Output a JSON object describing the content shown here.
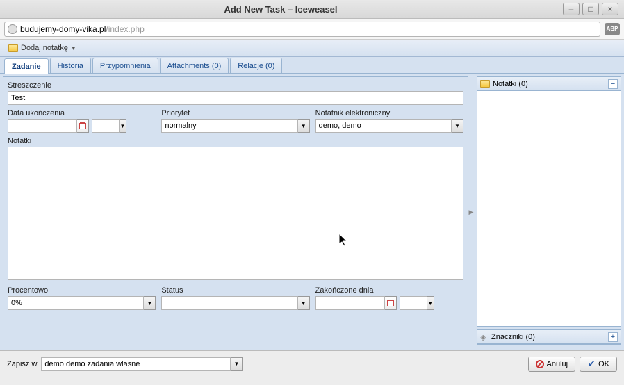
{
  "window": {
    "title": "Add New Task – Iceweasel"
  },
  "url": {
    "domain": "budujemy-domy-vika.pl",
    "path": "/index.php"
  },
  "abp": "ABP",
  "toolbar": {
    "add_note": "Dodaj notatkę"
  },
  "tabs": {
    "task": "Zadanie",
    "history": "Historia",
    "reminders": "Przypomnienia",
    "attachments": "Attachments (0)",
    "relations": "Relacje (0)"
  },
  "form": {
    "summary_label": "Streszczenie",
    "summary_value": "Test",
    "due_label": "Data ukończenia",
    "due_value": "",
    "due_time": "",
    "priority_label": "Priorytet",
    "priority_value": "normalny",
    "notebook_label": "Notatnik elektroniczny",
    "notebook_value": "demo, demo",
    "notes_label": "Notatki",
    "notes_value": "",
    "percent_label": "Procentowo",
    "percent_value": "0%",
    "status_label": "Status",
    "status_value": "",
    "completed_label": "Zakończone dnia",
    "completed_value": "",
    "completed_time": ""
  },
  "sidebar": {
    "notes_title": "Notatki (0)",
    "tags_title": "Znaczniki (0)"
  },
  "footer": {
    "save_label": "Zapisz w",
    "save_value": "demo demo zadania wlasne",
    "cancel": "Anuluj",
    "ok": "OK"
  }
}
